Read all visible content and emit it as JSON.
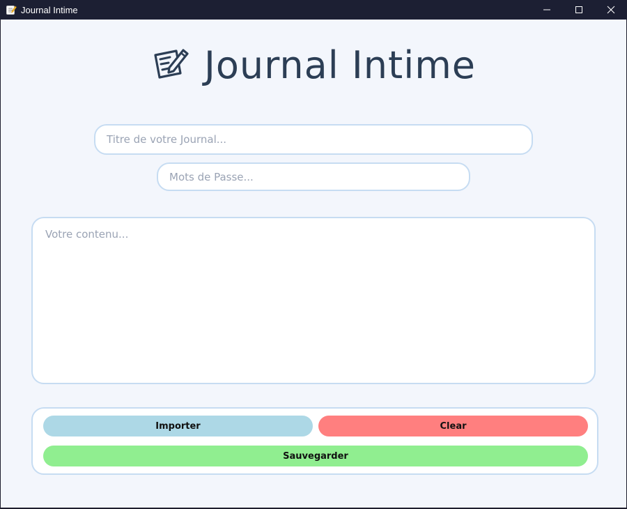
{
  "window": {
    "title": "Journal Intime",
    "app_icon": "memo-pencil-icon",
    "controls": [
      "minimize-icon",
      "maximize-icon",
      "close-icon"
    ]
  },
  "header": {
    "title": "Journal Intime",
    "icon": "memo-pencil-icon"
  },
  "form": {
    "title_placeholder": "Titre de votre Journal...",
    "title_value": "",
    "password_placeholder": "Mots de Passe...",
    "password_value": "",
    "content_placeholder": "Votre contenu...",
    "content_value": ""
  },
  "buttons": {
    "import_label": "Importer",
    "clear_label": "Clear",
    "save_label": "Sauvegarder"
  },
  "colors": {
    "background": "#f3f6fc",
    "title_text": "#2c3e55",
    "field_border": "#c6dcf2",
    "import_button": "#add8e6",
    "clear_button": "#ff7f7f",
    "save_button": "#90ee90",
    "titlebar": "#1c1f33"
  }
}
